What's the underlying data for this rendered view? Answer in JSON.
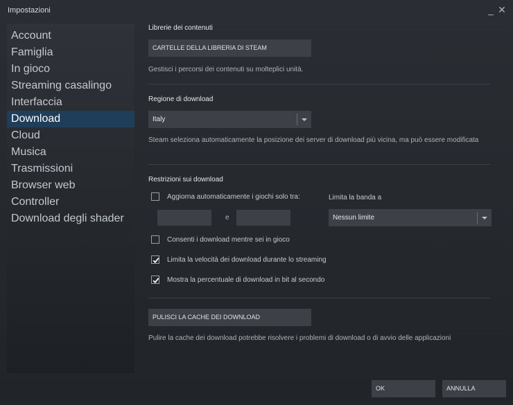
{
  "window": {
    "title": "Impostazioni",
    "minimize_glyph": "_",
    "close_glyph": "✕"
  },
  "sidebar": {
    "items": [
      {
        "label": "Account"
      },
      {
        "label": "Famiglia"
      },
      {
        "label": "In gioco"
      },
      {
        "label": "Streaming casalingo"
      },
      {
        "label": "Interfaccia"
      },
      {
        "label": "Download",
        "active": true
      },
      {
        "label": "Cloud"
      },
      {
        "label": "Musica"
      },
      {
        "label": "Trasmissioni"
      },
      {
        "label": "Browser web"
      },
      {
        "label": "Controller"
      },
      {
        "label": "Download degli shader"
      }
    ]
  },
  "content_libraries": {
    "title": "Librerie dei contenuti",
    "button": "CARTELLE DELLA LIBRERIA DI STEAM",
    "desc": "Gestisci i percorsi dei contenuti su molteplici unità."
  },
  "download_region": {
    "title": "Regione di download",
    "selected": "Italy",
    "desc": "Steam seleziona automaticamente la posizione dei server di download più vicina, ma può essere modificata"
  },
  "restrictions": {
    "title": "Restrizioni sui download",
    "auto_update": {
      "label": "Aggiorna automaticamente i giochi solo tra:",
      "checked": false,
      "from": "",
      "to": "",
      "and_label": "e"
    },
    "bandwidth": {
      "label": "Limita la banda a",
      "selected": "Nessun limite"
    },
    "allow_in_game": {
      "label": "Consenti i download mentre sei in gioco",
      "checked": false
    },
    "limit_streaming": {
      "label": "Limita la velocità dei download durante lo streaming",
      "checked": true
    },
    "show_bits": {
      "label": "Mostra la percentuale di download in bit al secondo",
      "checked": true
    }
  },
  "cache": {
    "button": "PULISCI LA CACHE DEI DOWNLOAD",
    "desc": "Pulire la cache dei download potrebbe risolvere i problemi di download o di avvio delle applicazioni"
  },
  "footer": {
    "ok": "OK",
    "cancel": "ANNULLA"
  },
  "colors": {
    "accent": "#1f3e5a",
    "background": "#262a2f",
    "control": "#3d4046"
  },
  "icons": {
    "checkbox_checked": "check-icon",
    "dropdown": "chevron-down-icon",
    "close": "close-icon",
    "minimize": "minimize-icon"
  }
}
